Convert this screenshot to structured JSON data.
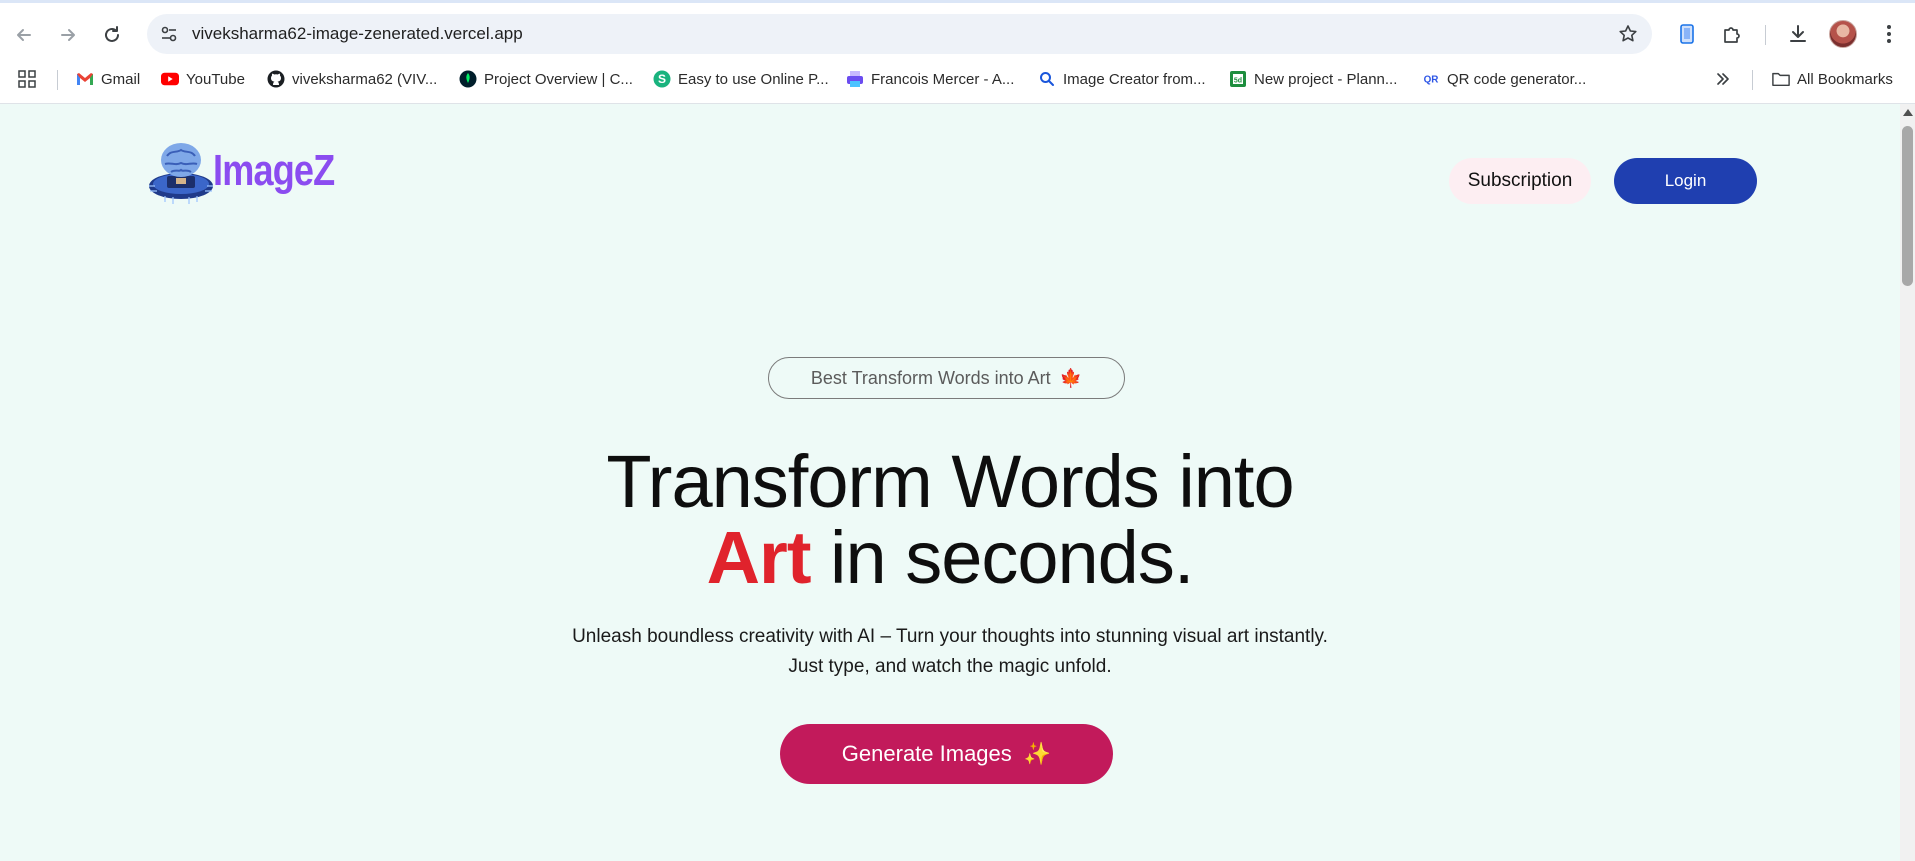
{
  "browser": {
    "url": "viveksharma62-image-zenerated.vercel.app",
    "bookmarks": [
      {
        "label": "Gmail",
        "icon": "gmail-icon"
      },
      {
        "label": "YouTube",
        "icon": "youtube-icon"
      },
      {
        "label": "viveksharma62 (VIV...",
        "icon": "github-icon"
      },
      {
        "label": "Project Overview | C...",
        "icon": "mongodb-icon"
      },
      {
        "label": "Easy to use Online P...",
        "icon": "s-logo-icon"
      },
      {
        "label": "Francois Mercer - A...",
        "icon": "printer-icon"
      },
      {
        "label": "Image Creator from...",
        "icon": "search-icon"
      },
      {
        "label": "New project - Plann...",
        "icon": "sheet-icon"
      },
      {
        "label": "QR code generator...",
        "icon": "qr-icon"
      }
    ],
    "all_bookmarks_label": "All Bookmarks"
  },
  "site": {
    "logo_text": "ImageZ",
    "nav": {
      "subscription_label": "Subscription",
      "login_label": "Login"
    },
    "hero": {
      "badge_text": "Best Transform Words into Art",
      "badge_emoji": "🍁",
      "title_line1": "Transform Words into",
      "title_accent": "Art",
      "title_line2_rest": " in seconds.",
      "description": "Unleash boundless creativity with AI – Turn your thoughts into stunning visual art instantly. Just type, and watch the magic unfold.",
      "cta_label": "Generate Images",
      "cta_emoji": "✨"
    }
  },
  "colors": {
    "page_bg": "#eefaf7",
    "logo": "#8b4cf0",
    "login_bg": "#1f3fb0",
    "subscription_bg": "#fdeef2",
    "accent_red": "#e0232c",
    "cta_bg": "#c21a5b"
  }
}
